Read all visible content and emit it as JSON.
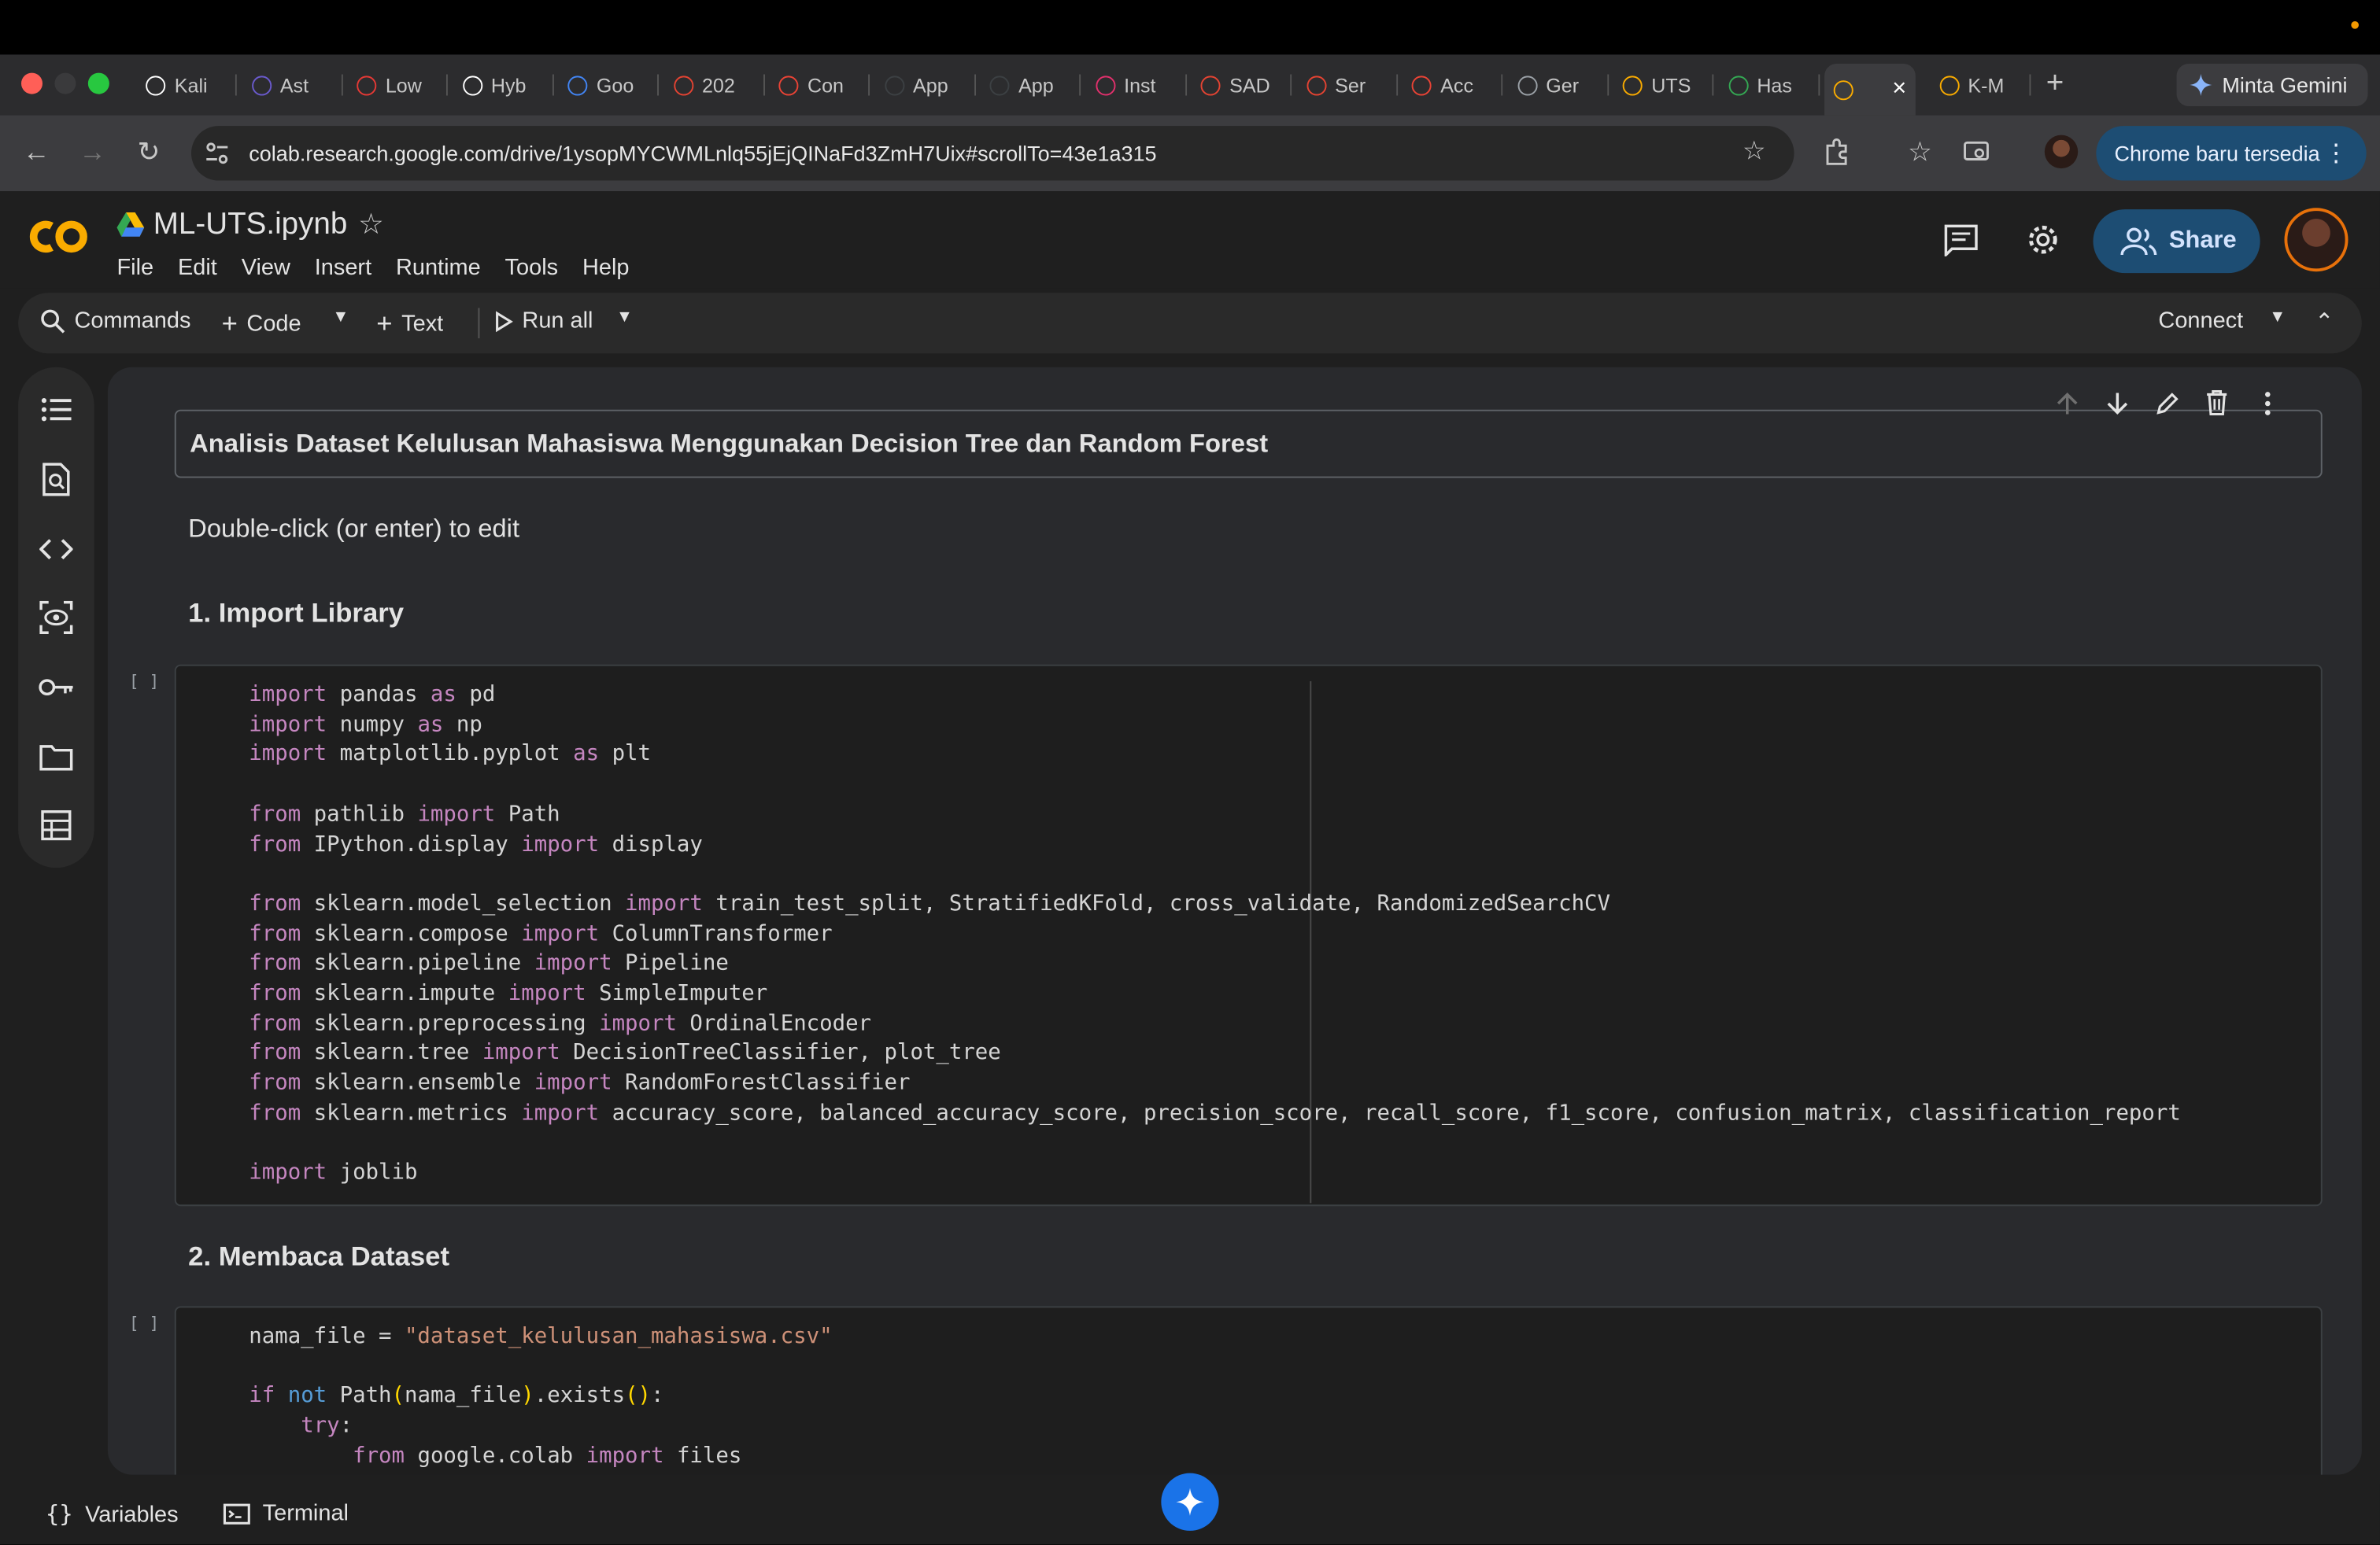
{
  "browser": {
    "tabs": [
      {
        "label": "Kali",
        "favicon": "openai-icon",
        "color": "#ffffff"
      },
      {
        "label": "Ast",
        "favicon": "astro-icon",
        "color": "#6a5acd"
      },
      {
        "label": "Low",
        "favicon": "lowongan-icon",
        "color": "#e53935"
      },
      {
        "label": "Hyb",
        "favicon": "openai-icon",
        "color": "#ffffff"
      },
      {
        "label": "Goo",
        "favicon": "gemini-icon",
        "color": "#4285f4"
      },
      {
        "label": "202",
        "favicon": "todoist-icon",
        "color": "#e44332"
      },
      {
        "label": "Con",
        "favicon": "gmail-icon",
        "color": "#ea4335"
      },
      {
        "label": "App",
        "favicon": "app-icon",
        "color": "#3c4043"
      },
      {
        "label": "App",
        "favicon": "app-icon",
        "color": "#3c4043"
      },
      {
        "label": "Inst",
        "favicon": "instagram-icon",
        "color": "#e1306c"
      },
      {
        "label": "SAD",
        "favicon": "todoist-icon",
        "color": "#e44332"
      },
      {
        "label": "Ser",
        "favicon": "todoist-icon",
        "color": "#e44332"
      },
      {
        "label": "Acc",
        "favicon": "gmail-icon",
        "color": "#ea4335"
      },
      {
        "label": "Ger",
        "favicon": "globe-icon",
        "color": "#9aa0a6"
      },
      {
        "label": "UTS",
        "favicon": "colab-icon",
        "color": "#f9ab00"
      },
      {
        "label": "Has",
        "favicon": "drive-icon",
        "color": "#34a853"
      },
      {
        "label": "",
        "favicon": "colab-icon",
        "color": "#f9ab00",
        "active": true
      },
      {
        "label": "K-M",
        "favicon": "colab-icon",
        "color": "#f9ab00"
      }
    ],
    "gemini_button": "Minta Gemini",
    "url": "colab.research.google.com/drive/1ysopMYCWMLnlq55jEjQINaFd3ZmH7Uix#scrollTo=43e1a315",
    "update_button": "Chrome baru tersedia"
  },
  "colab": {
    "notebook_title": "ML-UTS.ipynb",
    "menu": [
      "File",
      "Edit",
      "View",
      "Insert",
      "Runtime",
      "Tools",
      "Help"
    ],
    "share_label": "Share",
    "toolbar": {
      "commands": "Commands",
      "code": "Code",
      "text": "Text",
      "run_all": "Run all",
      "connect": "Connect"
    },
    "rail_icons": [
      "toc-icon",
      "find-icon",
      "code-snippets-icon",
      "variable-inspector-icon",
      "secrets-key-icon",
      "files-folder-icon",
      "data-table-icon"
    ],
    "cells": {
      "title": "Analisis Dataset Kelulusan Mahasiswa Menggunakan Decision Tree dan Random Forest",
      "edit_hint": "Double-click (or enter) to edit",
      "heading1": "1. Import Library",
      "heading2": "2. Membaca Dataset",
      "run_marker": "[ ]"
    },
    "bottom": {
      "variables": "Variables",
      "terminal": "Terminal"
    }
  },
  "colors": {
    "accent_blue": "#1d4d73",
    "colab_orange": "#f9ab00",
    "keyword": "#c586c0",
    "string": "#ce9178"
  }
}
